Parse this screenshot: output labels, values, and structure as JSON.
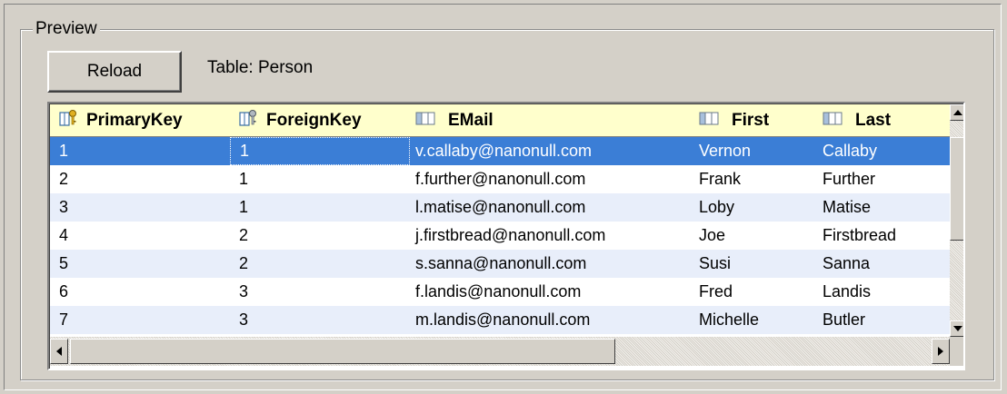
{
  "group": {
    "title": "Preview"
  },
  "toolbar": {
    "reload_label": "Reload",
    "table_label": "Table: Person"
  },
  "grid": {
    "columns": [
      {
        "label": "PrimaryKey",
        "icon": "primary-key-icon"
      },
      {
        "label": "ForeignKey",
        "icon": "foreign-key-icon"
      },
      {
        "label": "EMail",
        "icon": "column-icon"
      },
      {
        "label": "First",
        "icon": "column-icon"
      },
      {
        "label": "Last",
        "icon": "column-icon"
      }
    ],
    "rows": [
      [
        "1",
        "1",
        "v.callaby@nanonull.com",
        "Vernon",
        "Callaby"
      ],
      [
        "2",
        "1",
        "f.further@nanonull.com",
        "Frank",
        "Further"
      ],
      [
        "3",
        "1",
        "l.matise@nanonull.com",
        "Loby",
        "Matise"
      ],
      [
        "4",
        "2",
        "j.firstbread@nanonull.com",
        "Joe",
        "Firstbread"
      ],
      [
        "5",
        "2",
        "s.sanna@nanonull.com",
        "Susi",
        "Sanna"
      ],
      [
        "6",
        "3",
        "f.landis@nanonull.com",
        "Fred",
        "Landis"
      ],
      [
        "7",
        "3",
        "m.landis@nanonull.com",
        "Michelle",
        "Butler"
      ]
    ],
    "selected_row": 0
  },
  "colors": {
    "header_bg": "#ffffcc",
    "selected_bg": "#3b7ed6",
    "alt_row_bg": "#e8eefa"
  }
}
